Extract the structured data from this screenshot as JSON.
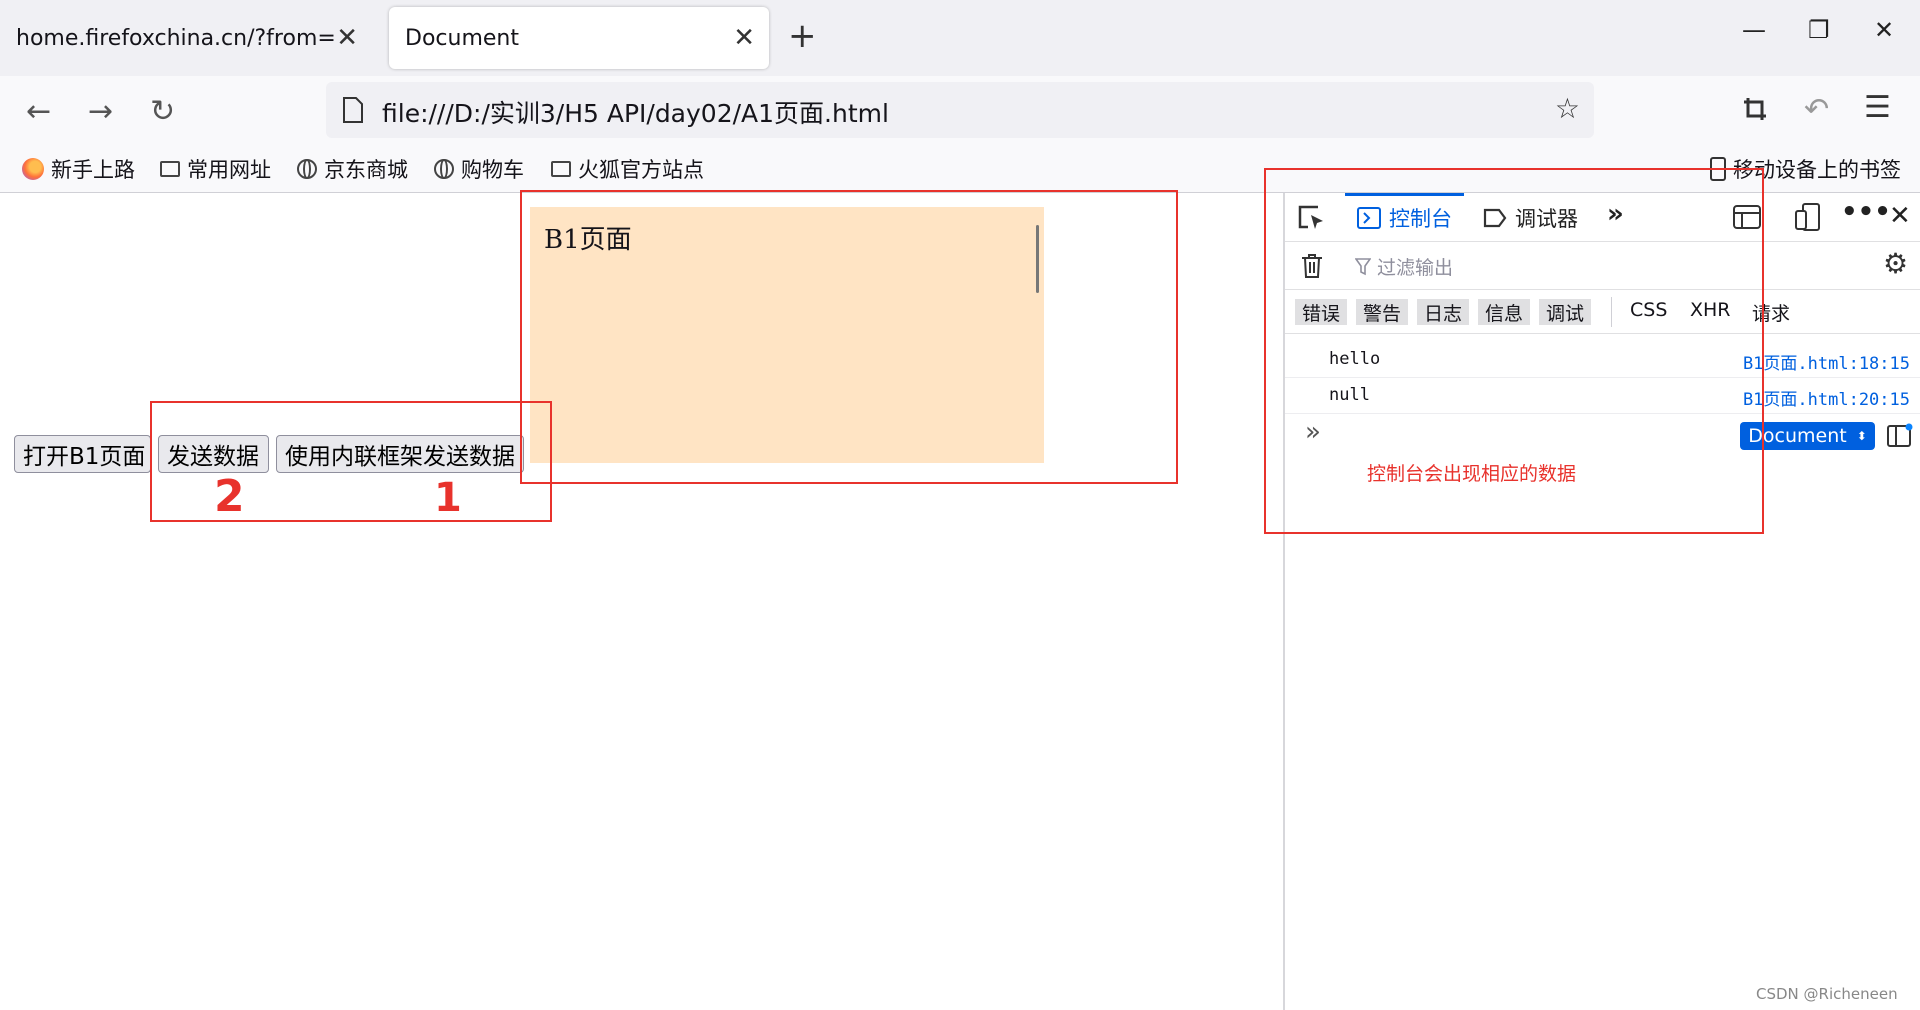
{
  "browser": {
    "tabs": [
      {
        "title": "home.firefoxchina.cn/?from=extr",
        "active": false
      },
      {
        "title": "Document",
        "active": true
      }
    ],
    "url": "file:///D:/实训3/H5 API/day02/A1页面.html"
  },
  "bookmarks": {
    "items": [
      "新手上路",
      "常用网址",
      "京东商城",
      "购物车",
      "火狐官方站点"
    ],
    "mobile": "移动设备上的书签"
  },
  "page": {
    "iframe_text": "B1页面",
    "buttons": {
      "open": "打开B1页面",
      "send": "发送数据",
      "send_iframe": "使用内联框架发送数据"
    },
    "handwritten": {
      "left": "2",
      "right": "1"
    }
  },
  "devtools": {
    "tabs": {
      "console": "控制台",
      "debugger": "调试器"
    },
    "filter_placeholder": "过滤输出",
    "levels": [
      "错误",
      "警告",
      "日志",
      "信息",
      "调试"
    ],
    "extra_filters": [
      "CSS",
      "XHR",
      "请求"
    ],
    "logs": [
      {
        "message": "hello",
        "source": "B1页面.html:18:15"
      },
      {
        "message": "null",
        "source": "B1页面.html:20:15"
      }
    ],
    "context": "Document"
  },
  "annotation": "控制台会出现相应的数据",
  "watermark": "CSDN @Richeneen",
  "colors": {
    "annotation_red": "#e8322c",
    "iframe_bg": "#ffe4c4",
    "accent_blue": "#0060df"
  }
}
